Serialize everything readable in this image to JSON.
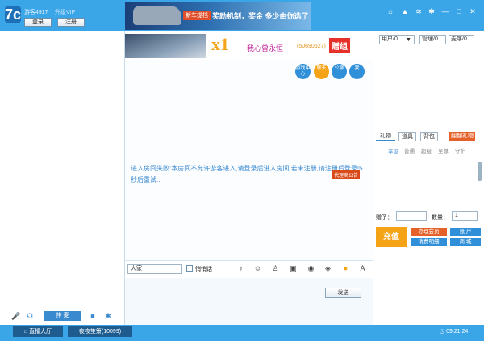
{
  "titlebar": {
    "logo": "7c",
    "guest_label": "游客4917",
    "guest_sub": "升级VIP",
    "login_label": "登录",
    "register_label": "注册",
    "banner_tag": "新车提档",
    "banner_text": "奖励机制，奖金 多少由你选了",
    "controls": [
      "home-icon",
      "shirt-icon",
      "wifi-icon",
      "settings-icon",
      "minimize-icon",
      "maximize-icon",
      "close-icon"
    ]
  },
  "gift_notice": {
    "multiplier": "x1",
    "sender": "我心曾永恒",
    "sender_id": "(50690627)",
    "badge": "赠组"
  },
  "room_buttons": [
    "游戏中心",
    "聊天",
    "公聊",
    "我"
  ],
  "chat": {
    "message": "进入房间失败:本房间不允许游客进入,请登录后进入房间!若未注册,请注册后登录!5秒后重试...",
    "bulletin": "代理商公告"
  },
  "composer": {
    "target": "大家",
    "whisper_label": "悄悄话",
    "send_label": "发送"
  },
  "right_tabs": {
    "users": "用户/0",
    "admins": "管理/0",
    "mics": "麦序/0"
  },
  "gift_panel": {
    "tabs": [
      "礼物",
      "道具",
      "背包"
    ],
    "free_gift": "翻翻礼物",
    "subtabs": [
      "幸运",
      "普通",
      "超级",
      "至尊",
      "守护"
    ],
    "recipient_label": "赠予：",
    "quantity_label": "数量：",
    "quantity_value": "1",
    "recharge_label": "充值",
    "membership": "办理会员",
    "account": "账 户",
    "consumption": "消费明细",
    "mall": "商 城"
  },
  "left_controls": {
    "queue_label": "排 麦"
  },
  "bottom": {
    "lobby_label": "直播大厅",
    "room_label": "夜夜笙箫(10099)",
    "clock": "09:21:24"
  },
  "colors": {
    "brand_blue": "#3aa6e8",
    "accent_orange": "#f5a316",
    "accent_red": "#e6312a"
  }
}
